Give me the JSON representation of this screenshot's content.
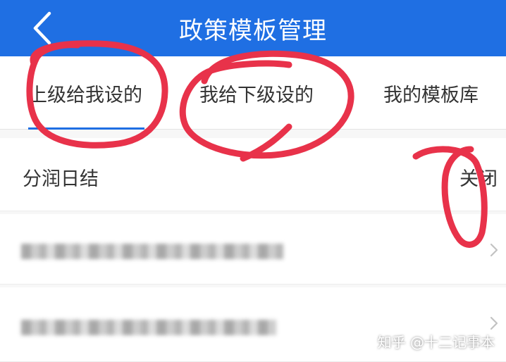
{
  "header": {
    "title": "政策模板管理",
    "back_icon": "chevron-left-icon",
    "background_color": "#1f6fe3"
  },
  "tabs": [
    {
      "label": "上级给我设的",
      "active": true
    },
    {
      "label": "我给下级设的",
      "active": false
    },
    {
      "label": "我的模板库",
      "active": false
    }
  ],
  "rows": [
    {
      "label": "分润日结",
      "value": "关闭"
    },
    {
      "label": "",
      "chevron": "chevron-right-icon"
    },
    {
      "label": "",
      "chevron": "chevron-right-icon"
    }
  ],
  "watermark": "知乎 @十二记事本",
  "colors": {
    "accent": "#1f6fe3",
    "annotation": "#e8324a"
  }
}
